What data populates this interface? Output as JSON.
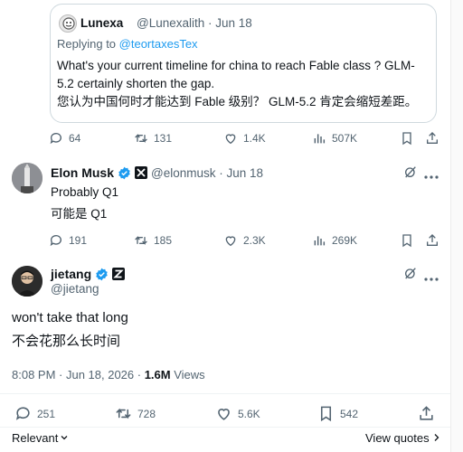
{
  "quoted_tweet": {
    "name": "Lunexa",
    "handle_date": "@Lunexalith · Jun 18",
    "replying_prefix": "Replying to ",
    "replying_handle": "@teortaxesTex",
    "text_en": "What's your current timeline for china to reach Fable class ? GLM-5.2 certainly shorten the gap.",
    "text_zh": "您认为中国何时才能达到 Fable 级别？ GLM-5.2 肯定会缩短差距。"
  },
  "quoted_actions": {
    "replies": "64",
    "reposts": "131",
    "likes": "1.4K",
    "views": "507K"
  },
  "reply_tweet": {
    "name": "Elon Musk",
    "handle_date": "@elonmusk · Jun 18",
    "text_en": "Probably Q1",
    "text_zh": "可能是 Q1"
  },
  "reply_actions": {
    "replies": "191",
    "reposts": "185",
    "likes": "2.3K",
    "views": "269K"
  },
  "main_tweet": {
    "name": "jietang",
    "handle": "@jietang",
    "text_en": "won't take that long",
    "text_zh": "不会花那么长时间",
    "timestamp": "8:08 PM · Jun 18, 2026 · ",
    "views_count": "1.6M",
    "views_label": " Views"
  },
  "main_actions": {
    "replies": "251",
    "reposts": "728",
    "likes": "5.6K",
    "bookmarks": "542"
  },
  "footer": {
    "relevant": "Relevant",
    "view_quotes": "View quotes"
  },
  "colors": {
    "accent": "#1d9bf0",
    "muted": "#536471",
    "text": "#0f1419",
    "border": "#cfd9de"
  },
  "icons": [
    "reply-icon",
    "repost-icon",
    "like-icon",
    "views-icon",
    "bookmark-icon",
    "share-icon",
    "grok-icon",
    "more-icon",
    "verified-icon",
    "x-logo-icon"
  ]
}
